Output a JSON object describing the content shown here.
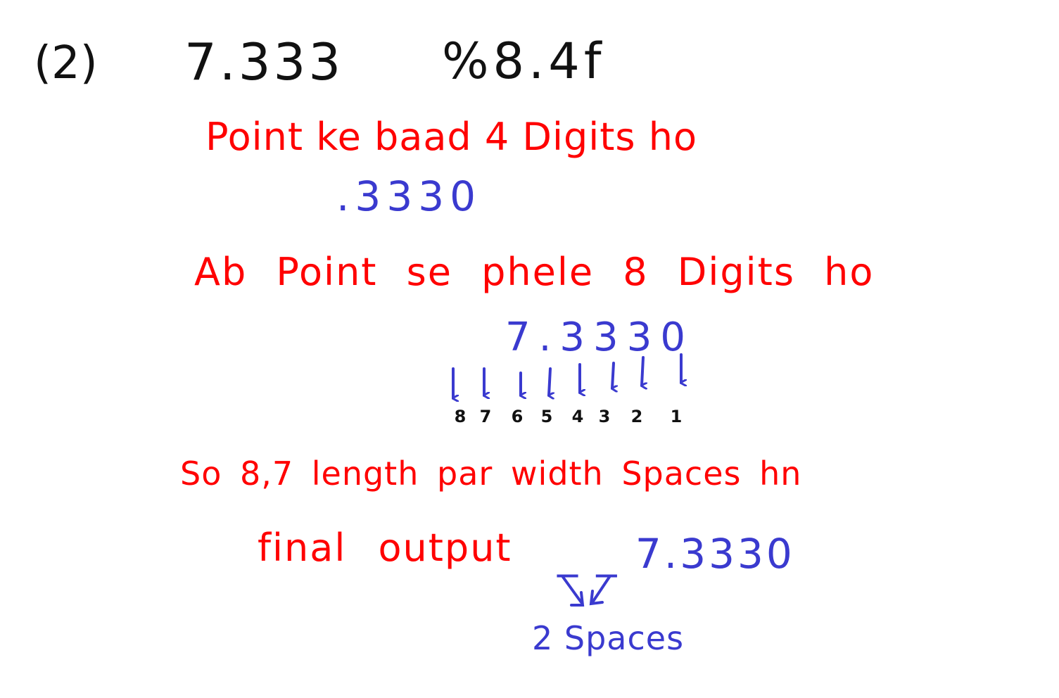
{
  "header": {
    "item_label": "(2)",
    "number": "7.333",
    "format_spec": "%8.4f"
  },
  "step1": {
    "text": "Point ke baad 4 Digits ho",
    "result": ".3330"
  },
  "step2": {
    "text": "Ab Point se phele 8 Digits ho",
    "digits": "7.3330",
    "positions": [
      "8",
      "7",
      "6",
      "5",
      "4",
      "3",
      "2",
      "1"
    ]
  },
  "step3": {
    "text": "So 8,7 length par width Spaces hn"
  },
  "final": {
    "label": "final output",
    "value": "_ _ 7.3330",
    "note": "2 Spaces"
  },
  "colors": {
    "black_ink": "#111111",
    "red_ink": "#ff0000",
    "blue_ink": "#3a3acf"
  }
}
